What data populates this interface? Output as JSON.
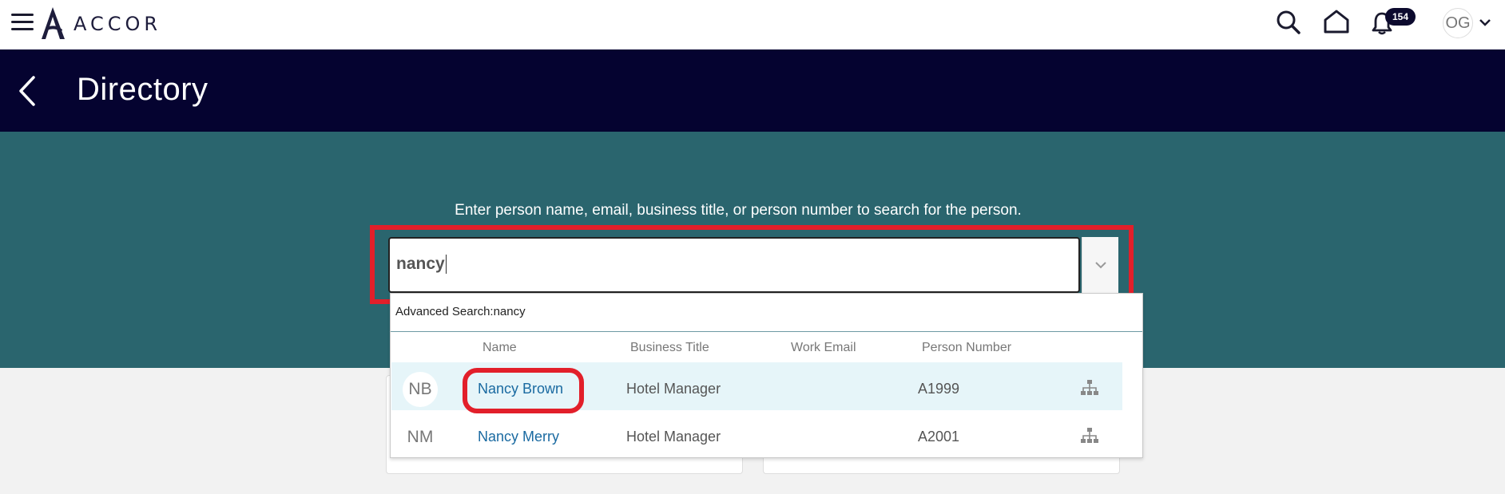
{
  "header": {
    "logo_text": "ACCOR",
    "notification_count": "154",
    "user_initials": "OG"
  },
  "page": {
    "title": "Directory"
  },
  "search": {
    "hint": "Enter person name, email, business title, or person number to search for the person.",
    "value": "nancy",
    "advanced_search": "Advanced Search:nancy"
  },
  "results": {
    "columns": [
      "Name",
      "Business Title",
      "Work Email",
      "Person Number"
    ],
    "rows": [
      {
        "initials": "NB",
        "name": "Nancy Brown",
        "title": "Hotel Manager",
        "email": "",
        "number": "A1999"
      },
      {
        "initials": "NM",
        "name": "Nancy Merry",
        "title": "Hotel Manager",
        "email": "",
        "number": "A2001"
      }
    ]
  },
  "colors": {
    "header_bg": "#050330",
    "band_bg": "#2a656e",
    "link": "#1a6aa1",
    "highlight": "#e21f2a"
  },
  "icons": [
    "menu-icon",
    "accor-logo-icon",
    "search-icon",
    "home-icon",
    "bell-icon",
    "chevron-down-icon",
    "back-arrow-icon",
    "org-chart-icon"
  ]
}
